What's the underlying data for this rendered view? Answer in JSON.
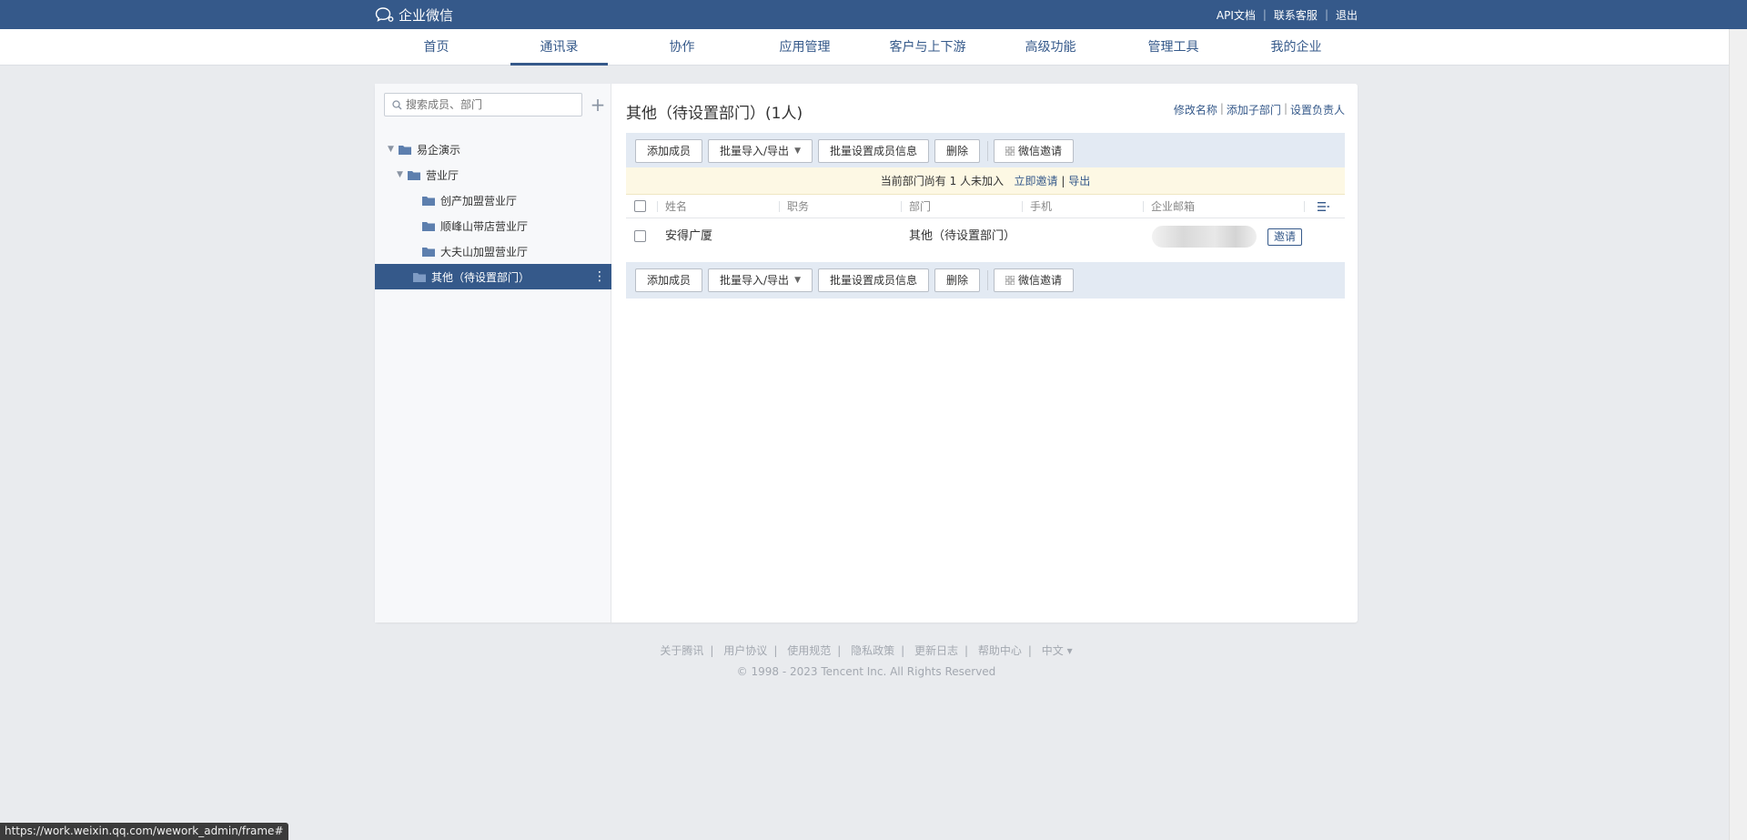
{
  "topbar": {
    "logo_text": "企业微信",
    "links": [
      "API文档",
      "联系客服",
      "退出"
    ]
  },
  "nav": {
    "tabs": [
      {
        "label": "首页"
      },
      {
        "label": "通讯录",
        "active": true
      },
      {
        "label": "协作"
      },
      {
        "label": "应用管理"
      },
      {
        "label": "客户与上下游"
      },
      {
        "label": "高级功能"
      },
      {
        "label": "管理工具"
      },
      {
        "label": "我的企业"
      }
    ]
  },
  "sidebar": {
    "search_placeholder": "搜索成员、部门",
    "tree": [
      {
        "label": "易企演示",
        "expanded": true
      },
      {
        "label": "营业厅",
        "expanded": true
      },
      {
        "label": "创产加盟营业厅"
      },
      {
        "label": "顺峰山带店营业厅"
      },
      {
        "label": "大夫山加盟营业厅"
      },
      {
        "label": "其他（待设置部门）",
        "selected": true
      }
    ]
  },
  "main": {
    "title": "其他（待设置部门）(1人)",
    "top_links": [
      "修改名称",
      "添加子部门",
      "设置负责人"
    ],
    "toolbar": {
      "add_member": "添加成员",
      "batch_import": "批量导入/导出",
      "batch_set": "批量设置成员信息",
      "delete": "删除",
      "wechat_invite": "微信邀请"
    },
    "notice": {
      "text": "当前部门尚有 1 人未加入",
      "invite_link": "立即邀请",
      "export_link": "导出"
    },
    "columns": [
      "姓名",
      "职务",
      "部门",
      "手机",
      "企业邮箱"
    ],
    "rows": [
      {
        "name": "安得广厦",
        "position": "",
        "department": "其他（待设置部门）",
        "phone": "",
        "invite_label": "邀请"
      }
    ]
  },
  "footer": {
    "links": [
      "关于腾讯",
      "用户协议",
      "使用规范",
      "隐私政策",
      "更新日志",
      "帮助中心",
      "中文 ▾"
    ],
    "copyright": "© 1998 - 2023 Tencent Inc. All Rights Reserved"
  },
  "status_url": "https://work.weixin.qq.com/wework_admin/frame#",
  "colors": {
    "brand": "#35598a",
    "toolbar_bg": "#e3eaf3",
    "notice_bg": "#fdf8e4"
  }
}
